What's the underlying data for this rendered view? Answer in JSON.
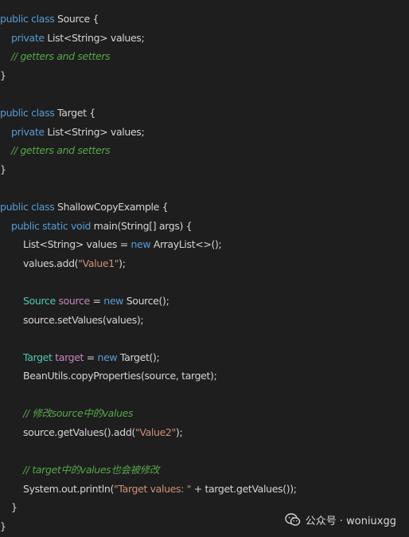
{
  "code_lines": [
    {
      "indent": 0,
      "tokens": [
        {
          "t": "public class ",
          "c": "kw"
        },
        {
          "t": "Source {",
          "c": "pl"
        }
      ]
    },
    {
      "indent": 1,
      "tokens": [
        {
          "t": "private ",
          "c": "kw"
        },
        {
          "t": "List<String> values;",
          "c": "pl"
        }
      ]
    },
    {
      "indent": 1,
      "tokens": [
        {
          "t": "// getters and setters",
          "c": "cm"
        }
      ]
    },
    {
      "indent": 0,
      "tokens": [
        {
          "t": "}",
          "c": "pl"
        }
      ]
    },
    {
      "indent": 0,
      "tokens": []
    },
    {
      "indent": 0,
      "tokens": [
        {
          "t": "public class ",
          "c": "kw"
        },
        {
          "t": "Target {",
          "c": "pl"
        }
      ]
    },
    {
      "indent": 1,
      "tokens": [
        {
          "t": "private ",
          "c": "kw"
        },
        {
          "t": "List<String> values;",
          "c": "pl"
        }
      ]
    },
    {
      "indent": 1,
      "tokens": [
        {
          "t": "// getters and setters",
          "c": "cm"
        }
      ]
    },
    {
      "indent": 0,
      "tokens": [
        {
          "t": "}",
          "c": "pl"
        }
      ]
    },
    {
      "indent": 0,
      "tokens": []
    },
    {
      "indent": 0,
      "tokens": [
        {
          "t": "public class ",
          "c": "kw"
        },
        {
          "t": "ShallowCopyExample {",
          "c": "pl"
        }
      ]
    },
    {
      "indent": 1,
      "tokens": [
        {
          "t": "public static void ",
          "c": "kw"
        },
        {
          "t": "main(String[] args) {",
          "c": "pl"
        }
      ]
    },
    {
      "indent": 2,
      "tokens": [
        {
          "t": "List<String> values = ",
          "c": "pl"
        },
        {
          "t": "new ",
          "c": "kw"
        },
        {
          "t": "ArrayList<>();",
          "c": "pl"
        }
      ]
    },
    {
      "indent": 2,
      "tokens": [
        {
          "t": "values.add(",
          "c": "pl"
        },
        {
          "t": "\"Value1\"",
          "c": "str"
        },
        {
          "t": ");",
          "c": "pl"
        }
      ]
    },
    {
      "indent": 0,
      "tokens": []
    },
    {
      "indent": 2,
      "tokens": [
        {
          "t": "Source ",
          "c": "ty"
        },
        {
          "t": "source",
          "c": "var"
        },
        {
          "t": " = ",
          "c": "pl"
        },
        {
          "t": "new ",
          "c": "kw"
        },
        {
          "t": "Source();",
          "c": "pl"
        }
      ]
    },
    {
      "indent": 2,
      "tokens": [
        {
          "t": "source.setValues(values);",
          "c": "pl"
        }
      ]
    },
    {
      "indent": 0,
      "tokens": []
    },
    {
      "indent": 2,
      "tokens": [
        {
          "t": "Target ",
          "c": "ty"
        },
        {
          "t": "target",
          "c": "var"
        },
        {
          "t": " = ",
          "c": "pl"
        },
        {
          "t": "new ",
          "c": "kw"
        },
        {
          "t": "Target();",
          "c": "pl"
        }
      ]
    },
    {
      "indent": 2,
      "tokens": [
        {
          "t": "BeanUtils.copyProperties(source, target);",
          "c": "pl"
        }
      ]
    },
    {
      "indent": 0,
      "tokens": []
    },
    {
      "indent": 2,
      "tokens": [
        {
          "t": "// 修改source中的values",
          "c": "cm"
        }
      ]
    },
    {
      "indent": 2,
      "tokens": [
        {
          "t": "source.getValues().add(",
          "c": "pl"
        },
        {
          "t": "\"Value2\"",
          "c": "str"
        },
        {
          "t": ");",
          "c": "pl"
        }
      ]
    },
    {
      "indent": 0,
      "tokens": []
    },
    {
      "indent": 2,
      "tokens": [
        {
          "t": "// target中的values也会被修改",
          "c": "cm"
        }
      ]
    },
    {
      "indent": 2,
      "tokens": [
        {
          "t": "System.out.println(",
          "c": "pl"
        },
        {
          "t": "\"Target values: \"",
          "c": "str"
        },
        {
          "t": " + target.getValues());",
          "c": "pl"
        }
      ]
    },
    {
      "indent": 1,
      "tokens": [
        {
          "t": "}",
          "c": "pl"
        }
      ]
    },
    {
      "indent": 0,
      "tokens": [
        {
          "t": "}",
          "c": "pl"
        }
      ]
    }
  ],
  "watermark": {
    "text": "公众号 · woniuxgg",
    "icon": "wechat-icon"
  },
  "colors": {
    "background": "#1e1e1e",
    "keyword": "#569cd6",
    "type": "#4ec9b0",
    "variable": "#c586c0",
    "string": "#ce9178",
    "comment": "#57a64a",
    "plain": "#d4d4d4"
  }
}
